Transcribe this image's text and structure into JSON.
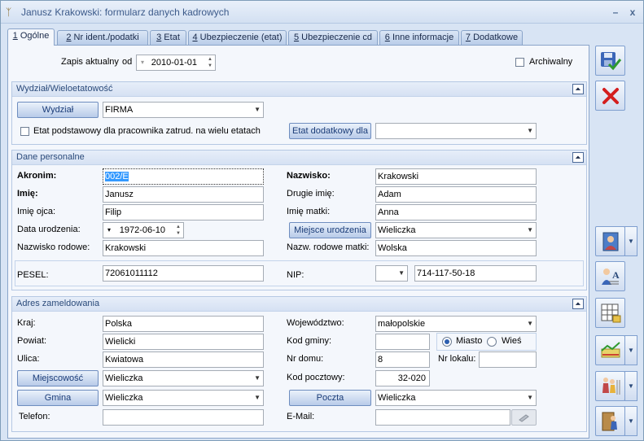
{
  "window": {
    "title": "Janusz Krakowski: formularz danych kadrowych",
    "minimize": "–",
    "close": "x"
  },
  "tabs": [
    {
      "num": "1",
      "label": " Ogólne"
    },
    {
      "num": "2",
      "label": " Nr ident./podatki"
    },
    {
      "num": "3",
      "label": " Etat"
    },
    {
      "num": "4",
      "label": " Ubezpieczenie (etat)"
    },
    {
      "num": "5",
      "label": " Ubezpieczenie cd"
    },
    {
      "num": "6",
      "label": " Inne informacje"
    },
    {
      "num": "7",
      "label": " Dodatkowe"
    }
  ],
  "top": {
    "zapis_label": "Zapis aktualny",
    "od_label": "od",
    "date_value": "2010-01-01",
    "archiwalny_label": "Archiwalny"
  },
  "wydzial": {
    "header": "Wydział/Wieloetatowość",
    "wydzial_button": "Wydział",
    "wydzial_value": "FIRMA",
    "etat_podst_label": "Etat podstawowy dla pracownika zatrud. na wielu etatach",
    "etat_dod_button": "Etat dodatkowy dla",
    "etat_dod_value": ""
  },
  "personal": {
    "header": "Dane personalne",
    "akronim_label": "Akronim:",
    "akronim_value": "002/E",
    "nazwisko_label": "Nazwisko:",
    "nazwisko_value": "Krakowski",
    "imie_label": "Imię:",
    "imie_value": "Janusz",
    "drugie_imie_label": "Drugie imię:",
    "drugie_imie_value": "Adam",
    "imie_ojca_label": "Imię ojca:",
    "imie_ojca_value": "Filip",
    "imie_matki_label": "Imię matki:",
    "imie_matki_value": "Anna",
    "data_ur_label": "Data urodzenia:",
    "data_ur_value": "1972-06-10",
    "miejsce_ur_button": "Miejsce urodzenia",
    "miejsce_ur_value": "Wieliczka",
    "nazw_rod_label": "Nazwisko rodowe:",
    "nazw_rod_value": "Krakowski",
    "nazw_rod_matki_label": "Nazw. rodowe matki:",
    "nazw_rod_matki_value": "Wolska",
    "pesel_label": "PESEL:",
    "pesel_value": "72061011112",
    "nip_label": "NIP:",
    "nip_prefix": "",
    "nip_value": "714-117-50-18"
  },
  "address": {
    "header": "Adres zameldowania",
    "kraj_label": "Kraj:",
    "kraj_value": "Polska",
    "woj_label": "Województwo:",
    "woj_value": "małopolskie",
    "powiat_label": "Powiat:",
    "powiat_value": "Wielicki",
    "kod_gminy_label": "Kod gminy:",
    "kod_gminy_value": "",
    "miasto_label": "Miasto",
    "wies_label": "Wieś",
    "ulica_label": "Ulica:",
    "ulica_value": "Kwiatowa",
    "nr_domu_label": "Nr domu:",
    "nr_domu_value": "8",
    "nr_lokalu_label": "Nr lokalu:",
    "nr_lokalu_value": "",
    "miejscowosc_button": "Miejscowość",
    "miejscowosc_value": "Wieliczka",
    "kod_poczt_label": "Kod pocztowy:",
    "kod_poczt_value": "32-020",
    "gmina_button": "Gmina",
    "gmina_value": "Wieliczka",
    "poczta_button": "Poczta",
    "poczta_value": "Wieliczka",
    "telefon_label": "Telefon:",
    "telefon_value": "",
    "email_label": "E-Mail:",
    "email_value": ""
  },
  "colors": {
    "accent": "#2d5fb0",
    "save_green": "#2e9a2e",
    "cancel_red": "#d41e1e"
  }
}
